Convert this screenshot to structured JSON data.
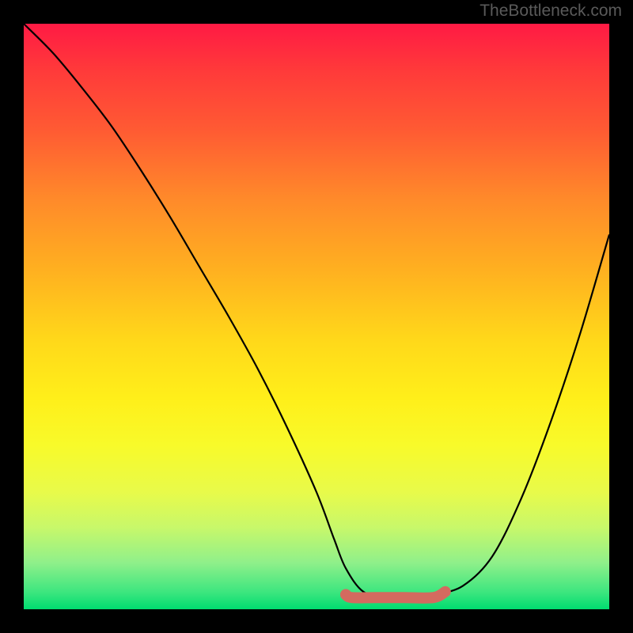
{
  "watermark": "TheBottleneck.com",
  "chart_data": {
    "type": "line",
    "title": "",
    "xlabel": "",
    "ylabel": "",
    "xlim": [
      0,
      100
    ],
    "ylim": [
      0,
      100
    ],
    "series": [
      {
        "name": "curve",
        "x": [
          0,
          5,
          10,
          15,
          20,
          25,
          30,
          35,
          40,
          45,
          50,
          53,
          55,
          58,
          62,
          66,
          70,
          75,
          80,
          85,
          90,
          95,
          100
        ],
        "y": [
          100,
          95,
          89,
          82.5,
          75,
          67,
          58.5,
          50,
          41,
          31,
          20,
          12,
          7,
          3,
          2,
          2,
          2.5,
          4,
          9,
          19,
          32,
          47,
          64
        ]
      },
      {
        "name": "highlight",
        "x": [
          55,
          56,
          60,
          65,
          70,
          72
        ],
        "y": [
          2.5,
          2,
          2,
          2,
          2,
          3
        ]
      }
    ],
    "highlight_color": "#d46a5f",
    "gradient_stops": [
      {
        "pos": 0,
        "color": "#ff1a44"
      },
      {
        "pos": 50,
        "color": "#ffd81a"
      },
      {
        "pos": 90,
        "color": "#90f08a"
      },
      {
        "pos": 100,
        "color": "#00dc70"
      }
    ]
  }
}
